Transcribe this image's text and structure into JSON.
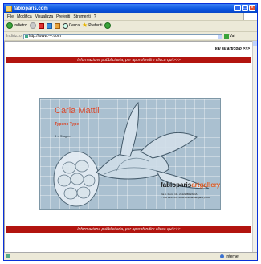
{
  "window": {
    "title": "fabioparis.com"
  },
  "menu": [
    "File",
    "Modifica",
    "Visualizza",
    "Preferiti",
    "Strumenti",
    "?"
  ],
  "toolbar": {
    "back_label": "Indietro",
    "search_label": "Cerca",
    "favorites_label": "Preferiti"
  },
  "address": {
    "label": "Indirizzo",
    "url": "http://www.---.com",
    "go_label": "Vai"
  },
  "page": {
    "top_link": "Vai all'articolo >>>",
    "banner_top": "Informazione pubblicitaria, per approfondire clicca qui >>>",
    "banner_bottom": "Informazione pubblicitaria, per approfondire clicca qui >>>",
    "card": {
      "artist": "Carla Mattii",
      "kind": "Typeno Type",
      "line": "3 > Stagno",
      "gallery_main": "fabioparis",
      "gallery_accent": "artgallery",
      "gallery_address": "Via A. Moro, 13 - 25122 BRESCIA",
      "gallery_contact": "T. 030 2944 09 - www.fabioparisartgallery.com"
    }
  },
  "status": {
    "zone": "Internet"
  },
  "colors": {
    "banner_red": "#b2140f",
    "artist_red": "#d9472a",
    "xp_blue": "#0a55e0"
  }
}
